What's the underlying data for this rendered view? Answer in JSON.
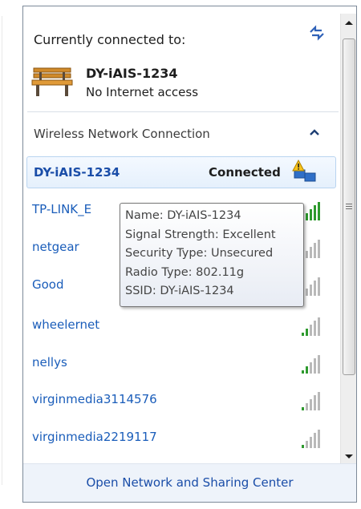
{
  "current": {
    "title": "Currently connected to:",
    "network_name": "DY-iAIS-1234",
    "status": "No Internet access"
  },
  "section": {
    "label": "Wireless Network Connection"
  },
  "networks": [
    {
      "name": "DY-iAIS-1234",
      "status": "Connected",
      "selected": true
    },
    {
      "name": "TP-LINK_E"
    },
    {
      "name": "netgear"
    },
    {
      "name": "Good"
    },
    {
      "name": "wheelernet"
    },
    {
      "name": "nellys"
    },
    {
      "name": "virginmedia3114576"
    },
    {
      "name": "virginmedia2219117"
    }
  ],
  "tooltip": {
    "lines": [
      "Name: DY-iAIS-1234",
      "Signal Strength: Excellent",
      "Security Type: Unsecured",
      "Radio Type: 802.11g",
      "SSID: DY-iAIS-1234"
    ]
  },
  "footer": {
    "link": "Open Network and Sharing Center"
  },
  "colors": {
    "link_blue": "#1a5dba",
    "selected_bg": "#e5f0fc",
    "footer_bg": "#eef3fa",
    "signal_green": "#2e9a2e"
  },
  "icons": {
    "refresh": "refresh-icon",
    "connection": "bench-icon",
    "collapse": "chevron-up-icon",
    "signal": "signal-bars-icon",
    "connected": "shield-warning-icon"
  },
  "scroll": {
    "position": 0.05,
    "visible_fraction": 0.75
  }
}
